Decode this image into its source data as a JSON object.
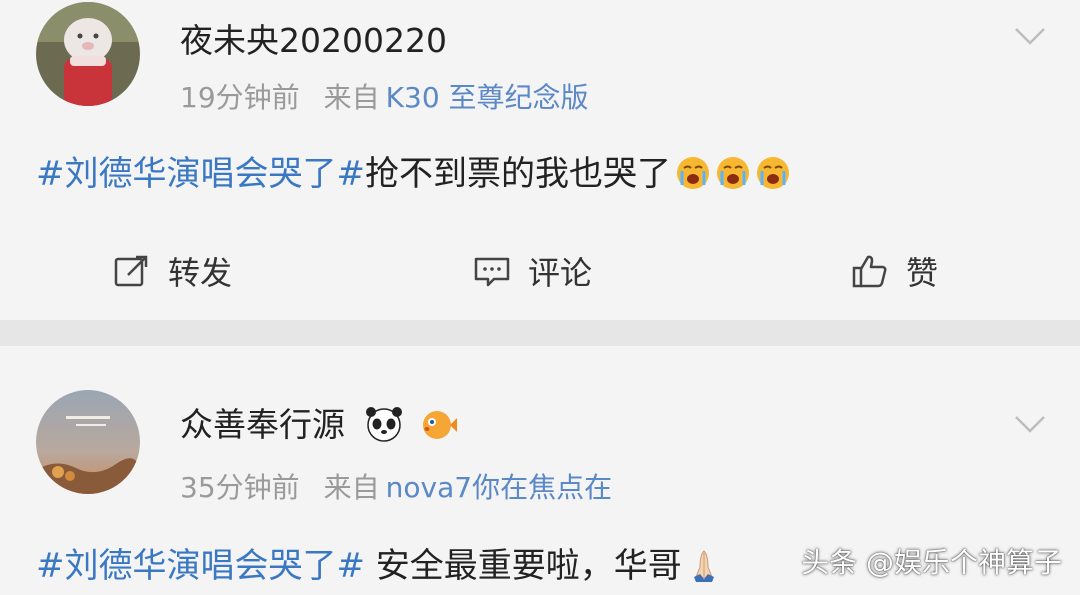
{
  "posts": [
    {
      "username": "夜未央20200220",
      "time": "19分钟前",
      "source_prefix": "来自",
      "source": "K30 至尊纪念版",
      "topic": "#刘德华演唱会哭了#",
      "text": "抢不到票的我也哭了",
      "emoji_icons": [
        "crying-face-icon",
        "crying-face-icon",
        "crying-face-icon"
      ]
    },
    {
      "username": "众善奉行源",
      "name_icons": [
        "panda-icon",
        "pufferfish-icon"
      ],
      "time": "35分钟前",
      "source_prefix": "来自",
      "source": "nova7你在焦点在",
      "topic": "#刘德华演唱会哭了#",
      "text": " 安全最重要啦，华哥",
      "emoji_icons": [
        "praying-hands-icon"
      ]
    }
  ],
  "actions": {
    "repost": "转发",
    "comment": "评论",
    "like": "赞"
  },
  "watermark": "头条 @娱乐个神算子",
  "colors": {
    "topic": "#3a78c3",
    "source": "#5b88c6",
    "meta": "#9a9a9a",
    "background": "#f4f4f4"
  }
}
